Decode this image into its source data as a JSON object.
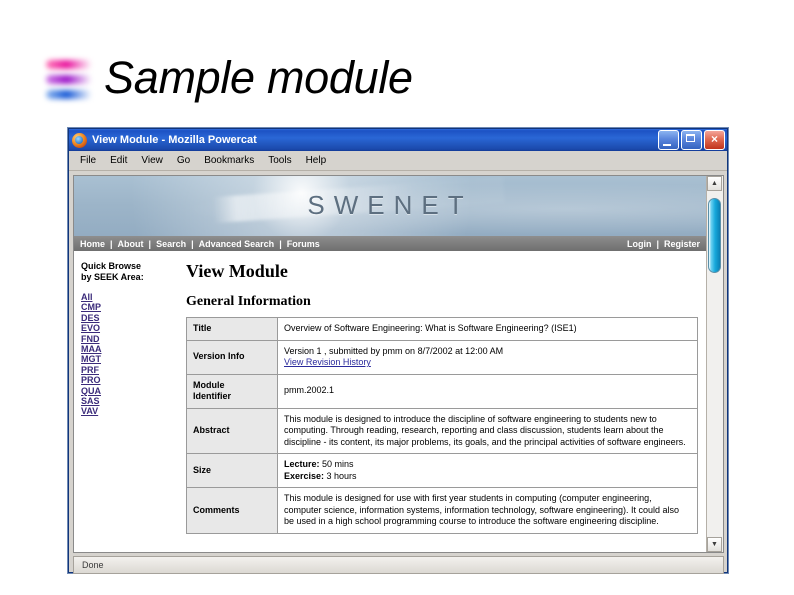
{
  "slide": {
    "title": "Sample module",
    "bullet_colors": [
      "#e8119c",
      "#9b14c8",
      "#1558d6"
    ]
  },
  "browser": {
    "window_title": "View Module - Mozilla Powercat",
    "app_icon": "firefox-icon",
    "controls": {
      "minimize": "minimize-icon",
      "maximize": "maximize-icon",
      "close": "×"
    },
    "menus": [
      "File",
      "Edit",
      "View",
      "Go",
      "Bookmarks",
      "Tools",
      "Help"
    ],
    "status_text": "Done",
    "scrollbar": {
      "up_arrow": "▲",
      "down_arrow": "▼",
      "thumb_color": "#17a9dc"
    }
  },
  "site": {
    "wordmark": "SWENET",
    "nav_left": [
      "Home",
      "About",
      "Search",
      "Advanced Search",
      "Forums"
    ],
    "nav_right": [
      "Login",
      "Register"
    ],
    "nav_separator": "|"
  },
  "sidebar": {
    "heading": "Quick Browse\nby SEEK Area:",
    "links": [
      "All",
      "CMP",
      "DES",
      "EVO",
      "FND",
      "MAA",
      "MGT",
      "PRF",
      "PRO",
      "QUA",
      "SAS",
      "VAV"
    ]
  },
  "main": {
    "page_title": "View Module",
    "section_title": "General Information",
    "rows": [
      {
        "label": "Title",
        "value": "Overview of Software Engineering: What is Software Engineering? (ISE1)"
      },
      {
        "label": "Version Info",
        "value": "Version 1 , submitted by pmm on 8/7/2002 at 12:00 AM",
        "link": "View Revision History"
      },
      {
        "label": "Module\nIdentifier",
        "value": "pmm.2002.1"
      },
      {
        "label": "Abstract",
        "value": "This module is designed to introduce the discipline of software engineering to students new to computing. Through reading, research, reporting and class discussion, students learn about the discipline - its content, its major problems, its goals, and the principal activities of software engineers."
      },
      {
        "label": "Size",
        "size_lines": [
          {
            "key": "Lecture:",
            "val": " 50 mins"
          },
          {
            "key": "Exercise:",
            "val": " 3 hours"
          }
        ]
      },
      {
        "label": "Comments",
        "value": "This module is designed for use with first year students in computing (computer engineering, computer science, information systems, information technology, software engineering). It could also be used in a high school programming course to introduce the software engineering discipline."
      }
    ]
  }
}
